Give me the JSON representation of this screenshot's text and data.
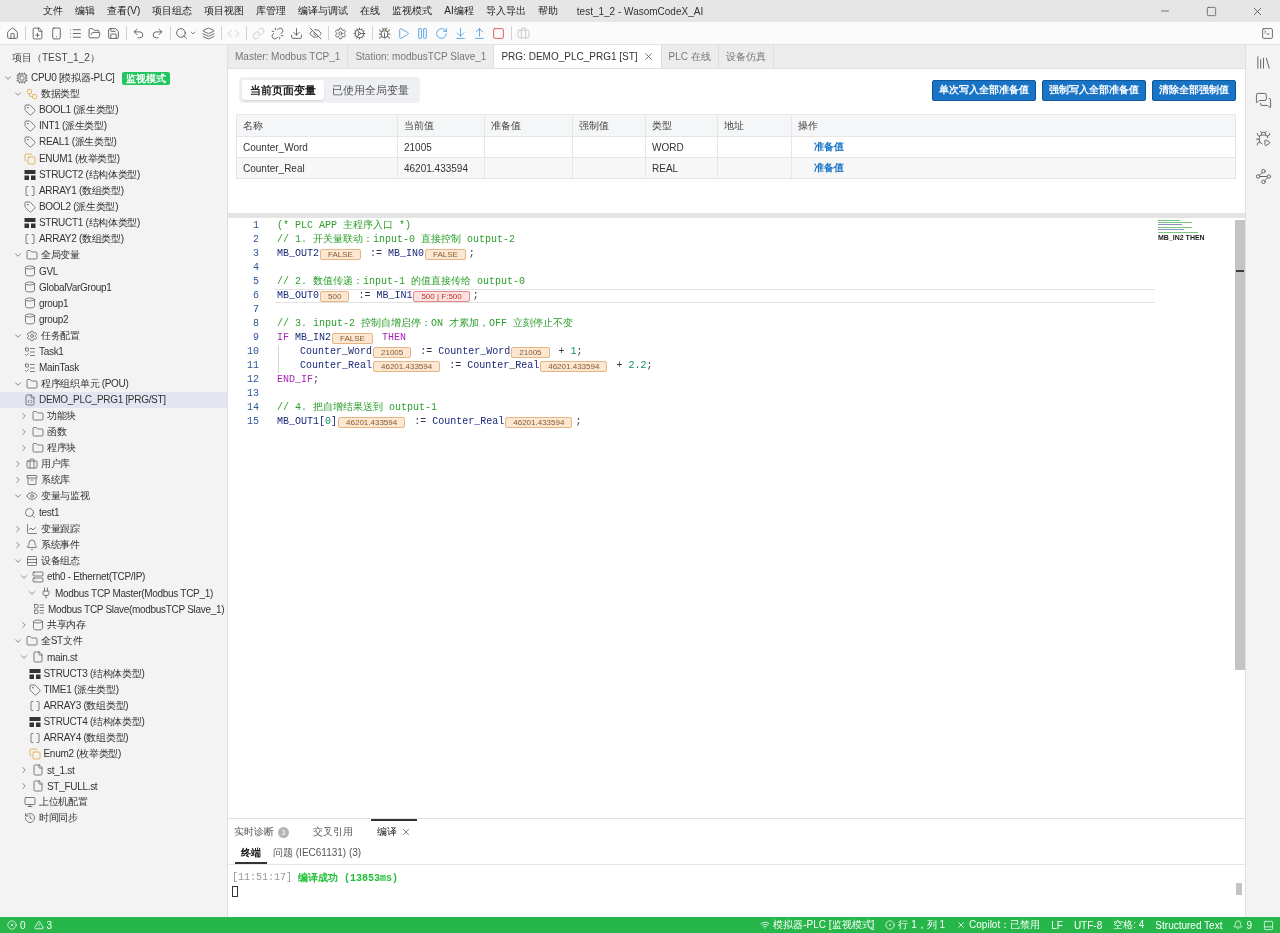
{
  "window": {
    "title": "test_1_2 - WasomCodeX_AI"
  },
  "menu": [
    "文件",
    "编辑",
    "查看(V)",
    "项目组态",
    "项目视图",
    "库管理",
    "编译与调试",
    "在线",
    "监视模式",
    "AI编程",
    "导入导出",
    "帮助"
  ],
  "toolbar": [
    {
      "disabled": false
    },
    {
      "disabled": false
    },
    {
      "disabled": false
    },
    {
      "disabled": false
    },
    {
      "disabled": false
    },
    {
      "disabled": false
    },
    {
      "disabled": false
    },
    {
      "disabled": false
    },
    {
      "disabled": false
    },
    {
      "disabled": false
    },
    {
      "disabled": true
    },
    {
      "disabled": true
    },
    {
      "disabled": false
    },
    {
      "disabled": false
    },
    {
      "disabled": false
    },
    {
      "disabled": false
    },
    {
      "disabled": false
    },
    {
      "disabled": false
    },
    {
      "disabled": false
    },
    {
      "disabled": false
    },
    {
      "disabled": false
    },
    {
      "disabled": false
    },
    {
      "disabled": false
    },
    {
      "disabled": false
    },
    {
      "disabled": true
    },
    {
      "disabled": false
    }
  ],
  "explorer": {
    "title": "项目（TEST_1_2）",
    "tree": [
      {
        "label": "CPU0 [模拟器-PLC]",
        "kind": "cpu",
        "badge": "监视模式",
        "expanded": true,
        "selected": false,
        "children": [
          {
            "label": "数据类型",
            "kind": "types",
            "expanded": true,
            "selected": false,
            "children": [
              {
                "label": "BOOL1 (派生类型)",
                "kind": "derived",
                "selected": false
              },
              {
                "label": "INT1 (派生类型)",
                "kind": "derived",
                "selected": false
              },
              {
                "label": "REAL1 (派生类型)",
                "kind": "derived",
                "selected": false
              },
              {
                "label": "ENUM1 (枚举类型)",
                "kind": "enum",
                "selected": false
              },
              {
                "label": "STRUCT2 (结构体类型)",
                "kind": "struct",
                "selected": false
              },
              {
                "label": "ARRAY1 (数组类型)",
                "kind": "array",
                "selected": false
              },
              {
                "label": "BOOL2 (派生类型)",
                "kind": "derived",
                "selected": false
              },
              {
                "label": "STRUCT1 (结构体类型)",
                "kind": "struct",
                "selected": false
              },
              {
                "label": "ARRAY2 (数组类型)",
                "kind": "array",
                "selected": false
              }
            ]
          },
          {
            "label": "全局变量",
            "kind": "folder",
            "expanded": true,
            "selected": false,
            "children": [
              {
                "label": "GVL",
                "kind": "storage",
                "selected": false
              },
              {
                "label": "GlobalVarGroup1",
                "kind": "storage",
                "selected": false
              },
              {
                "label": "group1",
                "kind": "storage",
                "selected": false
              },
              {
                "label": "group2",
                "kind": "storage",
                "selected": false
              }
            ]
          },
          {
            "label": "任务配置",
            "kind": "settings",
            "expanded": true,
            "selected": false,
            "children": [
              {
                "label": "Task1",
                "kind": "task",
                "selected": false
              },
              {
                "label": "MainTask",
                "kind": "task",
                "selected": false
              }
            ]
          },
          {
            "label": "程序组织单元 (POU)",
            "kind": "folder",
            "expanded": true,
            "selected": false,
            "children": [
              {
                "label": "DEMO_PLC_PRG1 [PRG/ST]",
                "kind": "program",
                "selected": true
              },
              {
                "label": "功能块",
                "kind": "folder",
                "expanded": false,
                "selected": false
              },
              {
                "label": "函数",
                "kind": "folder",
                "expanded": false,
                "selected": false
              },
              {
                "label": "程序块",
                "kind": "folder",
                "expanded": false,
                "selected": false
              }
            ]
          },
          {
            "label": "用户库",
            "kind": "library",
            "expanded": false,
            "selected": false
          },
          {
            "label": "系统库",
            "kind": "archive",
            "expanded": false,
            "selected": false
          },
          {
            "label": "变量与监视",
            "kind": "watch",
            "expanded": true,
            "selected": false,
            "children": [
              {
                "label": "test1",
                "kind": "search",
                "selected": false
              }
            ]
          },
          {
            "label": "变量跟踪",
            "kind": "trace",
            "expanded": false,
            "selected": false
          },
          {
            "label": "系统事件",
            "kind": "events",
            "expanded": false,
            "selected": false
          },
          {
            "label": "设备组态",
            "kind": "devices",
            "expanded": true,
            "selected": false,
            "children": [
              {
                "label": "eth0 - Ethernet(TCP/IP)",
                "kind": "ethernet",
                "expanded": true,
                "selected": false,
                "children": [
                  {
                    "label": "Modbus TCP Master(Modbus TCP_1)",
                    "kind": "master",
                    "expanded": true,
                    "selected": false,
                    "children": [
                      {
                        "label": "Modbus TCP Slave(modbusTCP Slave_1)",
                        "kind": "slave",
                        "selected": false
                      }
                    ]
                  }
                ]
              },
              {
                "label": "共享内存",
                "kind": "storage",
                "expanded": false,
                "selected": false
              }
            ]
          },
          {
            "label": "全ST文件",
            "kind": "folder",
            "expanded": true,
            "selected": false,
            "children": [
              {
                "label": "main.st",
                "kind": "file",
                "expanded": true,
                "selected": false,
                "children": [
                  {
                    "label": "STRUCT3 (结构体类型)",
                    "kind": "struct",
                    "selected": false
                  },
                  {
                    "label": "TIME1 (派生类型)",
                    "kind": "derived",
                    "selected": false
                  },
                  {
                    "label": "ARRAY3 (数组类型)",
                    "kind": "array",
                    "selected": false
                  },
                  {
                    "label": "STRUCT4 (结构体类型)",
                    "kind": "struct",
                    "selected": false
                  },
                  {
                    "label": "ARRAY4 (数组类型)",
                    "kind": "array",
                    "selected": false
                  },
                  {
                    "label": "Enum2 (枚举类型)",
                    "kind": "enum",
                    "selected": false
                  }
                ]
              },
              {
                "label": "st_1.st",
                "kind": "file",
                "expanded": false,
                "selected": false
              },
              {
                "label": "ST_FULL.st",
                "kind": "file",
                "expanded": false,
                "selected": false
              }
            ]
          },
          {
            "label": "上位机配置",
            "kind": "monitor",
            "selected": false
          },
          {
            "label": "时间同步",
            "kind": "history",
            "selected": false
          }
        ]
      }
    ]
  },
  "editor": {
    "tabs": [
      {
        "label": "Master: Modbus TCP_1",
        "selected": false
      },
      {
        "label": "Station: modbusTCP Slave_1",
        "selected": false
      },
      {
        "label": "PRG: DEMO_PLC_PRG1 [ST]",
        "selected": true
      },
      {
        "label": "PLC 在线",
        "selected": false
      },
      {
        "label": "设备仿真",
        "selected": false
      }
    ],
    "variables": {
      "views": [
        {
          "label": "当前页面变量",
          "selected": true
        },
        {
          "label": "已使用全局变量",
          "selected": false
        }
      ],
      "actions": [
        "单次写入全部准备值",
        "强制写入全部准备值",
        "清除全部强制值"
      ],
      "table": {
        "columns": [
          "名称",
          "当前值",
          "准备值",
          "强制值",
          "类型",
          "地址",
          "操作"
        ],
        "rows": [
          {
            "name": "Counter_Word",
            "value": "21005",
            "type": "WORD",
            "action": "准备值"
          },
          {
            "name": "Counter_Real",
            "value": "46201.433594",
            "type": "REAL",
            "action": "准备值"
          }
        ]
      }
    },
    "code": {
      "lines": [
        {
          "number": "1",
          "indented": false,
          "outlined": false,
          "tokens": [
            {
              "kind": "comment",
              "text": "(* PLC APP 主程序入口 *)"
            }
          ]
        },
        {
          "number": "2",
          "indented": false,
          "outlined": false,
          "tokens": [
            {
              "kind": "comment",
              "text": "// 1. 开关量联动：input-0 直接控制 output-2"
            }
          ]
        },
        {
          "number": "3",
          "indented": false,
          "outlined": false,
          "tokens": [
            {
              "kind": "identifier",
              "text": "MB_OUT2"
            },
            {
              "kind": "chip",
              "text": "FALSE"
            },
            {
              "kind": "operator",
              "text": " := "
            },
            {
              "kind": "identifier",
              "text": "MB_IN0"
            },
            {
              "kind": "chip",
              "text": "FALSE"
            },
            {
              "kind": "operator",
              "text": ";"
            }
          ]
        },
        {
          "number": "4",
          "indented": false,
          "outlined": false
        },
        {
          "number": "5",
          "indented": false,
          "outlined": false,
          "tokens": [
            {
              "kind": "comment",
              "text": "// 2. 数值传递：input-1 的值直接传给 output-0"
            }
          ]
        },
        {
          "number": "6",
          "indented": false,
          "outlined": true,
          "tokens": [
            {
              "kind": "identifier",
              "text": "MB_OUT0"
            },
            {
              "kind": "chip",
              "text": "500"
            },
            {
              "kind": "operator",
              "text": " := "
            },
            {
              "kind": "identifier",
              "text": "MB_IN1"
            },
            {
              "kind": "forced",
              "text": "500 | F:500"
            },
            {
              "kind": "operator",
              "text": ";"
            }
          ]
        },
        {
          "number": "7",
          "indented": false,
          "outlined": false
        },
        {
          "number": "8",
          "indented": false,
          "outlined": false,
          "tokens": [
            {
              "kind": "comment",
              "text": "// 3. input-2 控制自增启停：ON 才累加，OFF 立刻停止不变"
            }
          ]
        },
        {
          "number": "9",
          "indented": false,
          "outlined": false,
          "tokens": [
            {
              "kind": "keyword",
              "text": "IF "
            },
            {
              "kind": "identifier",
              "text": "MB_IN2"
            },
            {
              "kind": "chip",
              "text": "FALSE"
            },
            {
              "kind": "keyword",
              "text": " THEN"
            }
          ]
        },
        {
          "number": "10",
          "indented": true,
          "outlined": false,
          "tokens": [
            {
              "kind": "identifier",
              "text": "Counter_Word"
            },
            {
              "kind": "chip",
              "text": "21005"
            },
            {
              "kind": "operator",
              "text": " := "
            },
            {
              "kind": "identifier",
              "text": "Counter_Word"
            },
            {
              "kind": "chip",
              "text": "21005"
            },
            {
              "kind": "operator",
              "text": " + "
            },
            {
              "kind": "number",
              "text": "1"
            },
            {
              "kind": "operator",
              "text": ";"
            }
          ]
        },
        {
          "number": "11",
          "indented": true,
          "outlined": false,
          "tokens": [
            {
              "kind": "identifier",
              "text": "Counter_Real"
            },
            {
              "kind": "chip",
              "text": "46201.433594"
            },
            {
              "kind": "operator",
              "text": " := "
            },
            {
              "kind": "identifier",
              "text": "Counter_Real"
            },
            {
              "kind": "chip",
              "text": "46201.433594"
            },
            {
              "kind": "operator",
              "text": " + "
            },
            {
              "kind": "number",
              "text": "2.2"
            },
            {
              "kind": "operator",
              "text": ";"
            }
          ]
        },
        {
          "number": "12",
          "indented": false,
          "outlined": false,
          "tokens": [
            {
              "kind": "keyword",
              "text": "END_IF"
            },
            {
              "kind": "operator",
              "text": ";"
            }
          ]
        },
        {
          "number": "13",
          "indented": false,
          "outlined": false
        },
        {
          "number": "14",
          "indented": false,
          "outlined": false,
          "tokens": [
            {
              "kind": "comment",
              "text": "// 4. 把自增结果送到 output-1"
            }
          ]
        },
        {
          "number": "15",
          "indented": false,
          "outlined": false,
          "tokens": [
            {
              "kind": "identifier",
              "text": "MB_OUT1["
            },
            {
              "kind": "number",
              "text": "0"
            },
            {
              "kind": "identifier",
              "text": "]"
            },
            {
              "kind": "chip",
              "text": "46201.433594"
            },
            {
              "kind": "operator",
              "text": " := "
            },
            {
              "kind": "identifier",
              "text": "Counter_Real"
            },
            {
              "kind": "chip",
              "text": "46201.433594"
            },
            {
              "kind": "operator",
              "text": ";"
            }
          ]
        }
      ]
    },
    "minimap": {
      "label": "MB_IN2 THEN"
    }
  },
  "bottom_panel": {
    "tabs": [
      {
        "label": "实时诊断",
        "badge": "3",
        "selected": false
      },
      {
        "label": "交叉引用",
        "selected": false
      },
      {
        "label": "编译",
        "selected": true
      }
    ],
    "subtabs": [
      {
        "label": "终端",
        "selected": true
      },
      {
        "label": "问题 (IEC61131) (3)",
        "selected": false
      }
    ],
    "terminal": {
      "lines": [
        {
          "time": "[11:51:17]",
          "message": "编译成功 (13853ms)"
        }
      ]
    }
  },
  "status_bar": {
    "problems": [
      {
        "kind": "error",
        "count": "0"
      },
      {
        "kind": "warning",
        "count": "3"
      }
    ],
    "items": [
      {
        "kind": "mode",
        "text": "模拟器-PLC [监视模式]"
      },
      {
        "kind": "cursor",
        "text": "行 1，列 1"
      },
      {
        "kind": "copilot",
        "text": "Copilot：已禁用"
      },
      {
        "kind": "plain",
        "text": "LF"
      },
      {
        "kind": "plain",
        "text": "UTF-8"
      },
      {
        "kind": "plain",
        "text": "空格: 4"
      },
      {
        "kind": "plain",
        "text": "Structured Text"
      },
      {
        "kind": "notifications",
        "text": "9"
      }
    ]
  }
}
